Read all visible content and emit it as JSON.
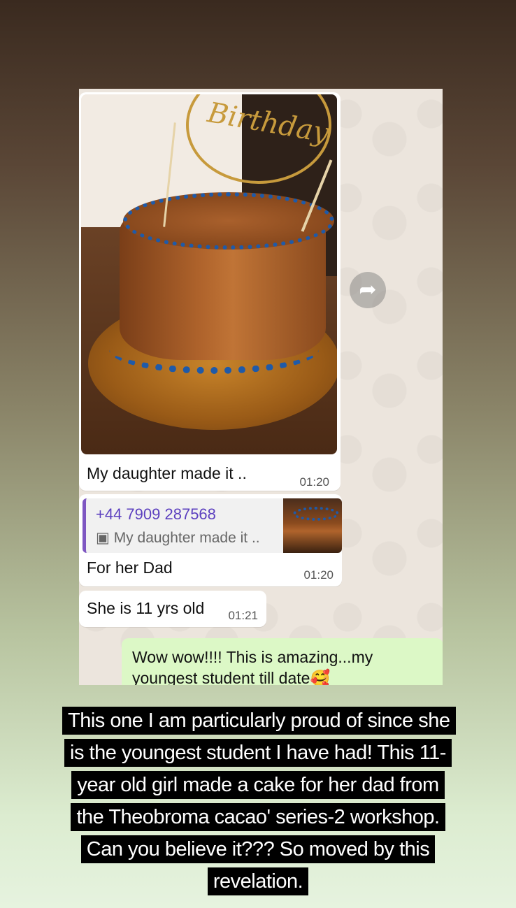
{
  "chat": {
    "image_message": {
      "caption": "My daughter made it ..",
      "time": "01:20",
      "topper_text": "Birthday"
    },
    "forward_icon": "forward-arrow-icon",
    "reply_message": {
      "quoted_sender": "+44 7909 287568",
      "quoted_caption": "My daughter made it ..",
      "text": "For her Dad",
      "time": "01:20"
    },
    "age_message": {
      "text": "She is 11 yrs old",
      "time": "01:21"
    },
    "outgoing_message": {
      "text": "Wow wow!!!! This is amazing...my youngest student till date🥰"
    }
  },
  "story_caption": "This one I am particularly proud of since she is the youngest student I have had! This 11-year old girl made a cake for her dad from the Theobroma cacao' series-2 workshop. Can you believe it??? So moved by this revelation."
}
